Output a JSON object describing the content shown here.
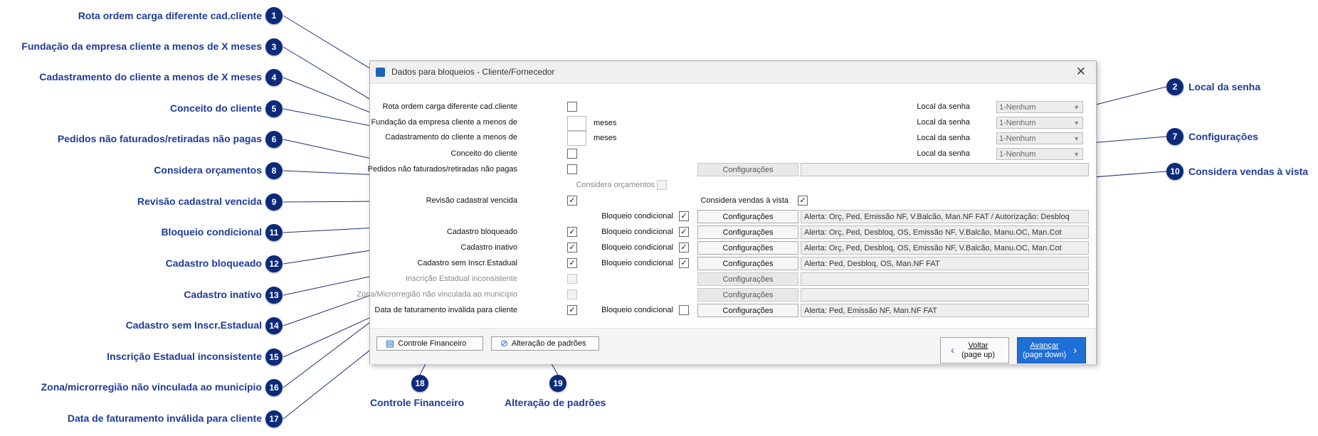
{
  "window": {
    "title": "Dados para bloqueios - Cliente/Fornecedor",
    "close_icon": "close-icon"
  },
  "rows": {
    "rota_label": "Rota ordem carga diferente cad.cliente",
    "fundacao_label": "Fundação da empresa cliente a menos de",
    "cadastramento_label": "Cadastramento do cliente a menos de",
    "meses": "meses",
    "conceito_label": "Conceito do cliente",
    "pedidos_label": "Pedidos não faturados/retiradas não pagas",
    "orcamentos_label": "Considera orçamentos",
    "revisao_label": "Revisão cadastral vencida",
    "vendas_vista_label": "Considera vendas à vista",
    "bloqueio_cond_label": "Bloqueio condicional",
    "cad_bloqueado_label": "Cadastro bloqueado",
    "cad_inativo_label": "Cadastro inativo",
    "cad_sem_ie_label": "Cadastro sem Inscr.Estadual",
    "ie_inconsistente_label": "Inscrição Estadual inconsistente",
    "zona_label": "Zona/Microrregião não vinculada ao município",
    "data_fat_label": "Data de faturamento inválida para cliente"
  },
  "senha": {
    "label": "Local da senha",
    "value": "1-Nenhum"
  },
  "config_button": "Configurações",
  "alerts": {
    "bloqueio_cond": "Alerta: Orç, Ped, Emissão NF, V.Balcão, Man.NF FAT / Autorização: Desbloq",
    "cad_bloqueado": "Alerta: Orç, Ped, Desbloq, OS, Emissão NF, V.Balcão, Manu.OC, Man.Cot",
    "cad_inativo": "Alerta: Orç, Ped, Desbloq, OS, Emissão NF, V.Balcão, Manu.OC, Man.Cot",
    "cad_sem_ie": "Alerta: Ped, Desbloq, OS, Man.NF FAT",
    "data_fat": "Alerta: Ped, Emissão NF, Man.NF FAT"
  },
  "footer": {
    "controle_financeiro": "Controle Financeiro",
    "alteracao_padroes": "Alteração de padrões",
    "voltar": "Voltar",
    "voltar_sub": "(page up)",
    "avancar": "Avançar",
    "avancar_sub": "(page down)"
  },
  "callouts": [
    {
      "num": "1",
      "text": "Rota ordem carga diferente cad.cliente"
    },
    {
      "num": "2",
      "text": "Local da senha"
    },
    {
      "num": "3",
      "text": "Fundação da empresa cliente a menos de X meses"
    },
    {
      "num": "4",
      "text": "Cadastramento do cliente a menos de X meses"
    },
    {
      "num": "5",
      "text": "Conceito do cliente"
    },
    {
      "num": "6",
      "text": "Pedidos não faturados/retiradas não pagas"
    },
    {
      "num": "7",
      "text": "Configurações"
    },
    {
      "num": "8",
      "text": "Considera orçamentos"
    },
    {
      "num": "9",
      "text": "Revisão cadastral vencida"
    },
    {
      "num": "10",
      "text": "Considera vendas à vista"
    },
    {
      "num": "11",
      "text": "Bloqueio condicional"
    },
    {
      "num": "12",
      "text": "Cadastro bloqueado"
    },
    {
      "num": "13",
      "text": "Cadastro inativo"
    },
    {
      "num": "14",
      "text": "Cadastro sem Inscr.Estadual"
    },
    {
      "num": "15",
      "text": "Inscrição Estadual inconsistente"
    },
    {
      "num": "16",
      "text": "Zona/microrregião não vinculada ao município"
    },
    {
      "num": "17",
      "text": "Data de faturamento inválida para cliente"
    },
    {
      "num": "18",
      "text": "Controle Financeiro"
    },
    {
      "num": "19",
      "text": "Alteração de padrões"
    }
  ],
  "colors": {
    "callout_text": "#1f3b97",
    "badge": "#0c2a7a",
    "accent": "#1e63b4"
  }
}
